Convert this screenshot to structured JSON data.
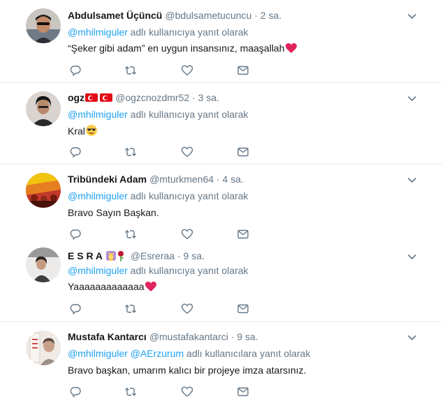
{
  "tweets": [
    {
      "name": "Abdulsamet Üçüncü",
      "handle": "@bdulsametucuncu",
      "dot": "·",
      "time": "2 sa.",
      "reply_mention": "@mhilmiguler",
      "reply_suffix": " adlı kullanıcıya yanıt olarak",
      "text": "“Şeker gibi adam” en uygun insansınız, maaşallah"
    },
    {
      "name": "ogz",
      "handle": "@ogzcnozdmr52",
      "dot": "·",
      "time": "3 sa.",
      "reply_mention": "@mhilmiguler",
      "reply_suffix": " adlı kullanıcıya yanıt olarak",
      "text": "Kral"
    },
    {
      "name": "Tribündeki Adam",
      "handle": "@mturkmen64",
      "dot": "·",
      "time": "4 sa.",
      "reply_mention": "@mhilmiguler",
      "reply_suffix": " adlı kullanıcıya yanıt olarak",
      "text": "Bravo Sayın Başkan."
    },
    {
      "name": "E S R A",
      "handle": "@Esreraa",
      "dot": "·",
      "time": "9 sa.",
      "reply_mention": "@mhilmiguler",
      "reply_suffix": " adlı kullanıcıya yanıt olarak",
      "text": "Yaaaaaaaaaaaaa"
    },
    {
      "name": "Mustafa Kantarcı",
      "handle": "@mustafakantarci",
      "dot": "·",
      "time": "9 sa.",
      "reply_mention": "@mhilmiguler",
      "reply_mention_2": "@AErzurum",
      "reply_suffix": " adlı kullanıcılara yanıt olarak",
      "text": "Bravo başkan, umarım kalıcı bir projeye imza atarsınız."
    }
  ],
  "colors": {
    "link": "#1da1f2",
    "secondary": "#657786",
    "primary": "#14171a",
    "heart": "#e0245e",
    "separator": "#e6ecf0"
  },
  "icons": {
    "reply": "reply-icon",
    "retweet": "retweet-icon",
    "like": "like-icon",
    "dm": "direct-message-icon",
    "caret": "chevron-down-icon"
  }
}
